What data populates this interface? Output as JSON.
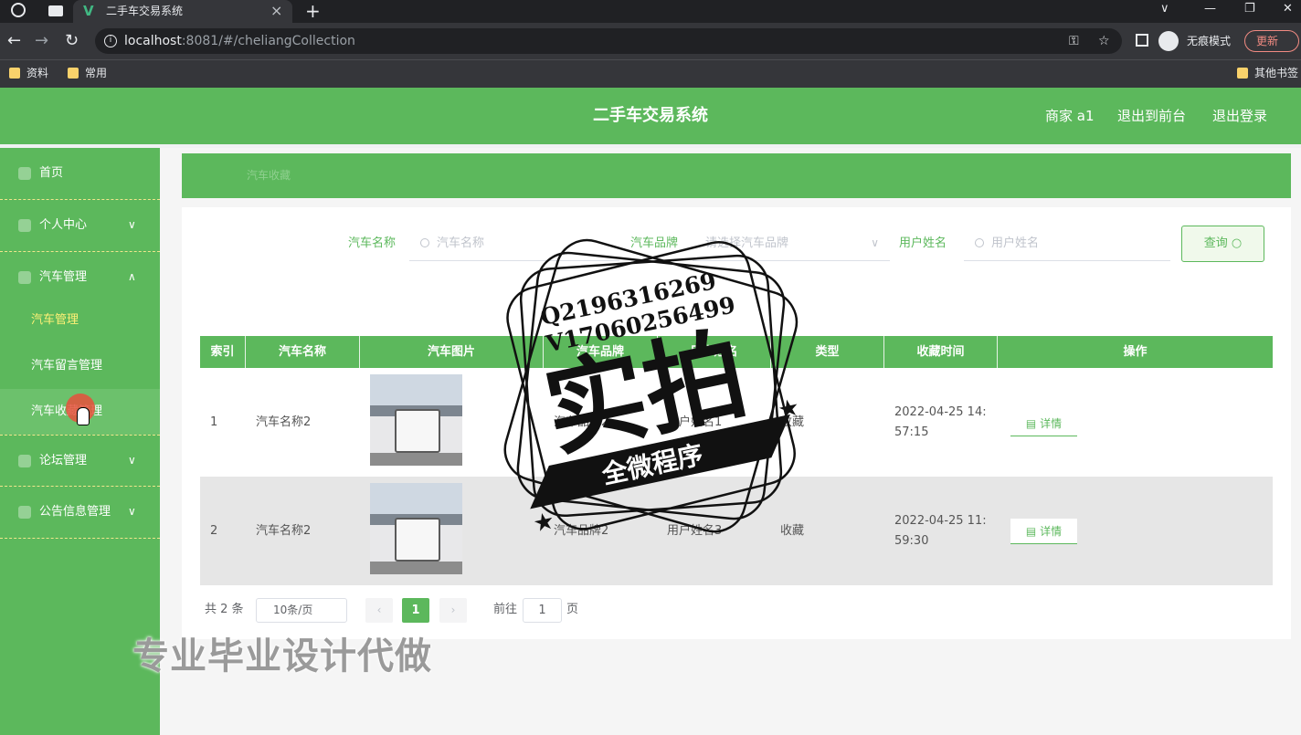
{
  "browser": {
    "tab_title": "二手车交易系统",
    "url_host": "localhost",
    "url_rest": ":8081/#/cheliangCollection",
    "incognito_label": "无痕模式",
    "update_label": "更新",
    "bookmarks": [
      "资料",
      "常用"
    ],
    "other_bookmarks": "其他书签"
  },
  "header": {
    "title": "二手车交易系统",
    "user": "商家 a1",
    "to_front": "退出到前台",
    "logout": "退出登录"
  },
  "sidebar": {
    "items": [
      {
        "label": "首页"
      },
      {
        "label": "个人中心",
        "chevron": "∨"
      },
      {
        "label": "汽车管理",
        "chevron": "∧"
      },
      {
        "label": "论坛管理",
        "chevron": "∨"
      },
      {
        "label": "公告信息管理",
        "chevron": "∨"
      }
    ],
    "subitems": [
      {
        "label": "汽车管理"
      },
      {
        "label": "汽车留言管理"
      },
      {
        "label": "汽车收藏管理"
      }
    ]
  },
  "breadcrumb": "汽车收藏",
  "filters": {
    "name_label": "汽车名称",
    "name_placeholder": "汽车名称",
    "brand_label": "汽车品牌",
    "brand_placeholder": "请选择汽车品牌",
    "user_label": "用户姓名",
    "user_placeholder": "用户姓名",
    "query_button": "查询"
  },
  "table": {
    "columns": [
      "索引",
      "汽车名称",
      "汽车图片",
      "汽车品牌",
      "用户姓名",
      "类型",
      "收藏时间",
      "操作"
    ],
    "rows": [
      {
        "index": "1",
        "name": "汽车名称2",
        "brand": "汽车品牌2",
        "user": "用户姓名1",
        "type": "收藏",
        "time_a": "2022-04-25 14:",
        "time_b": "57:15",
        "action": "详情"
      },
      {
        "index": "2",
        "name": "汽车名称2",
        "brand": "汽车品牌2",
        "user": "用户姓名3",
        "type": "收藏",
        "time_a": "2022-04-25 11:",
        "time_b": "59:30",
        "action": "详情"
      }
    ]
  },
  "pagination": {
    "total": "共 2 条",
    "page_size": "10条/页",
    "current": "1",
    "goto_prefix": "前往",
    "goto_value": "1",
    "goto_suffix": "页"
  },
  "watermarks": {
    "qq": "Q2196316269",
    "vx": "V17060256499",
    "big": "实拍",
    "ribbon": "全微程序",
    "bottom": "专业毕业设计代做"
  },
  "colors": {
    "brand_green": "#5cb85c",
    "active_submenu": "#fff176",
    "page_current": "#5cb85c"
  }
}
